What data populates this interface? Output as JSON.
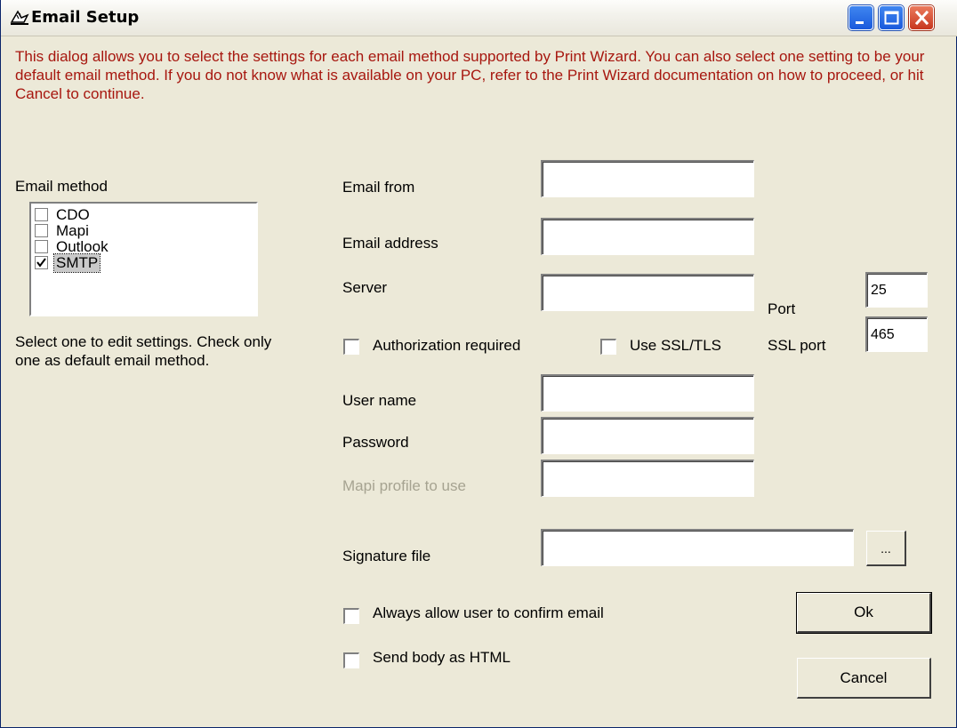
{
  "window": {
    "title": "Email Setup"
  },
  "intro_text": "This dialog allows you to select the settings for each email method supported by Print Wizard. You can also select one setting to be your default email method. If you do not know what is available on your PC, refer to the Print Wizard documentation on how to proceed, or hit Cancel to continue.",
  "email_method": {
    "label": "Email method",
    "items": [
      {
        "label": "CDO",
        "checked": false
      },
      {
        "label": "Mapi",
        "checked": false
      },
      {
        "label": "Outlook",
        "checked": false
      },
      {
        "label": "SMTP",
        "checked": true,
        "selected": true
      }
    ],
    "hint": "Select one to edit settings. Check only one as default email method."
  },
  "fields": {
    "email_from": {
      "label": "Email from",
      "value": ""
    },
    "email_address": {
      "label": "Email address",
      "value": ""
    },
    "server": {
      "label": "Server",
      "value": ""
    },
    "port": {
      "label": "Port",
      "value": "25"
    },
    "ssl_port": {
      "label": "SSL port",
      "value": "465"
    },
    "user_name": {
      "label": "User name",
      "value": ""
    },
    "password": {
      "label": "Password",
      "value": ""
    },
    "mapi_profile": {
      "label": "Mapi profile to use",
      "value": "",
      "disabled": true
    },
    "signature_file": {
      "label": "Signature file",
      "value": ""
    }
  },
  "checkboxes": {
    "authorization_required": {
      "label": "Authorization required",
      "checked": false
    },
    "use_ssl_tls": {
      "label": "Use SSL/TLS",
      "checked": false
    },
    "always_confirm": {
      "label": "Always allow user to confirm email",
      "checked": false
    },
    "send_html": {
      "label": "Send body as HTML",
      "checked": false
    }
  },
  "buttons": {
    "browse": "...",
    "ok": "Ok",
    "cancel": "Cancel"
  },
  "colors": {
    "intro_text": "#a7170f",
    "dialog_bg": "#ece9d8",
    "disabled_text": "#a6a391"
  },
  "icons": {
    "app": "wizard-hat-icon",
    "minimize": "minimize-icon",
    "maximize": "maximize-icon",
    "close": "close-icon"
  }
}
